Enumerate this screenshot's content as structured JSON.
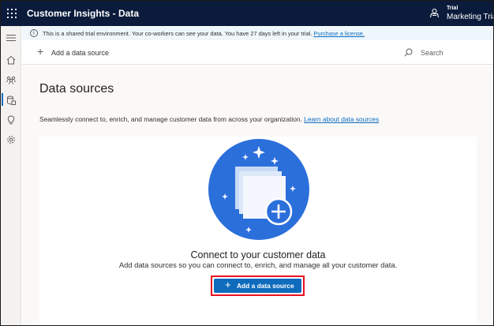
{
  "app": {
    "title": "Customer Insights - Data",
    "env_type": "Trial",
    "env_name": "Marketing Trial"
  },
  "nav": {
    "items": [
      {
        "name": "menu-toggle",
        "icon": "hamburger-icon"
      },
      {
        "name": "home",
        "icon": "home-icon"
      },
      {
        "name": "unify",
        "icon": "people-icon"
      },
      {
        "name": "data",
        "icon": "database-icon",
        "active": true
      },
      {
        "name": "insights",
        "icon": "lightbulb-icon"
      },
      {
        "name": "settings",
        "icon": "gear-icon"
      }
    ]
  },
  "notice": {
    "text": "This is a shared trial environment. Your co-workers can see your data. You have 27 days left in your trial.",
    "link": "Purchase a license."
  },
  "command_bar": {
    "add_label": "Add a data source",
    "search_placeholder": "Search"
  },
  "page": {
    "title": "Data sources",
    "description": "Seamlessly connect to, enrich, and manage customer data from across your organization.",
    "learn_link": "Learn about data sources"
  },
  "empty_state": {
    "title": "Connect to your customer data",
    "subtitle": "Add data sources so you can connect to, enrich, and manage all your customer data.",
    "button_label": "Add a data source"
  },
  "colors": {
    "topbar": "#0b1b3b",
    "accent": "#0f6cbd",
    "highlight": "#e81123",
    "illustration": "#2b6fdb"
  }
}
